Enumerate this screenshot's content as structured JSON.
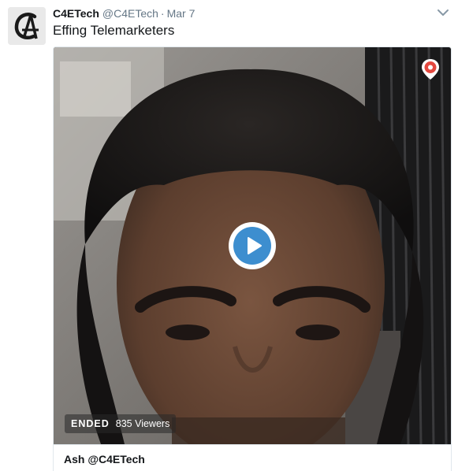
{
  "tweet": {
    "display_name": "C4ETech",
    "handle": "@C4ETech",
    "separator": "·",
    "timestamp": "Mar 7",
    "text": "Effing Telemarketers"
  },
  "icons": {
    "avatar": "c4e-logo-avatar",
    "caret": "chevron-down-icon",
    "periscope": "periscope-icon",
    "play": "play-icon"
  },
  "card": {
    "status_label": "ENDED",
    "viewers": "835 Viewers",
    "title": "Ash @C4ETech"
  },
  "colors": {
    "play_accent": "#3d8ecf",
    "periscope_accent": "#e4483f",
    "muted_text": "#657786"
  }
}
